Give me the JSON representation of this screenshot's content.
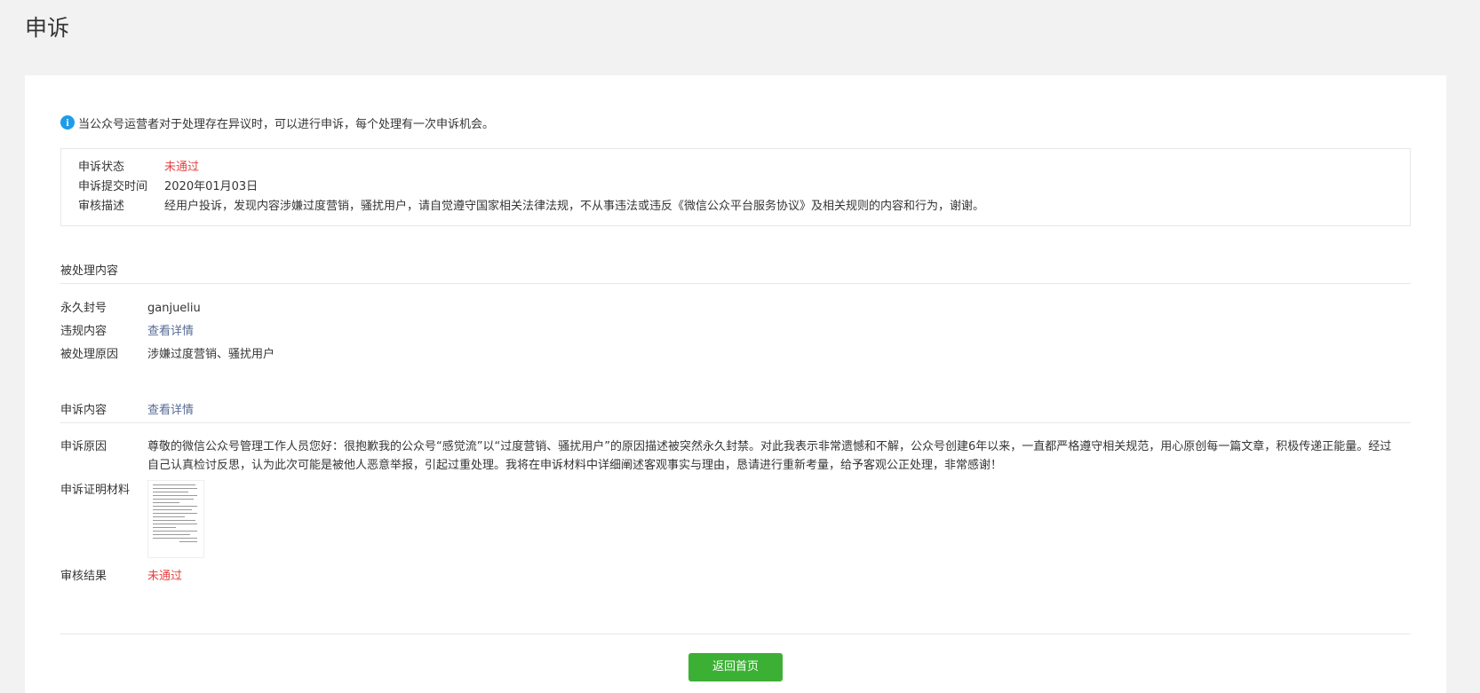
{
  "page": {
    "title": "申诉"
  },
  "notice": {
    "text": "当公众号运营者对于处理存在异议时，可以进行申诉，每个处理有一次申诉机会。"
  },
  "status": {
    "state_label": "申诉状态",
    "state_value": "未通过",
    "time_label": "申诉提交时间",
    "time_value": "2020年01月03日",
    "desc_label": "审核描述",
    "desc_value": "经用户投诉，发现内容涉嫌过度营销，骚扰用户，请自觉遵守国家相关法律法规，不从事违法或违反《微信公众平台服务协议》及相关规则的内容和行为，谢谢。"
  },
  "handled": {
    "header": "被处理内容",
    "ban_label": "永久封号",
    "ban_value": "ganjueliu",
    "violation_label": "违规内容",
    "violation_link": "查看详情",
    "reason_label": "被处理原因",
    "reason_value": "涉嫌过度营销、骚扰用户"
  },
  "appeal": {
    "header": "申诉内容",
    "header_link": "查看详情",
    "reason_label": "申诉原因",
    "reason_value": "尊敬的微信公众号管理工作人员您好：很抱歉我的公众号“感觉流”以“过度营销、骚扰用户”的原因描述被突然永久封禁。对此我表示非常遗憾和不解，公众号创建6年以来，一直都严格遵守相关规范，用心原创每一篇文章，积极传递正能量。经过自己认真检讨反思，认为此次可能是被他人恶意举报，引起过重处理。我将在申诉材料中详细阐述客观事实与理由，恳请进行重新考量，给予客观公正处理，非常感谢！",
    "evidence_label": "申诉证明材料",
    "result_label": "审核结果",
    "result_value": "未通过"
  },
  "footer": {
    "back_button": "返回首页"
  },
  "colors": {
    "accent_green": "#3cb034",
    "error_red": "#e64340",
    "link_blue": "#576b95",
    "info_blue": "#1f9ce8"
  },
  "icons": {
    "notice_icon": "info-icon"
  }
}
